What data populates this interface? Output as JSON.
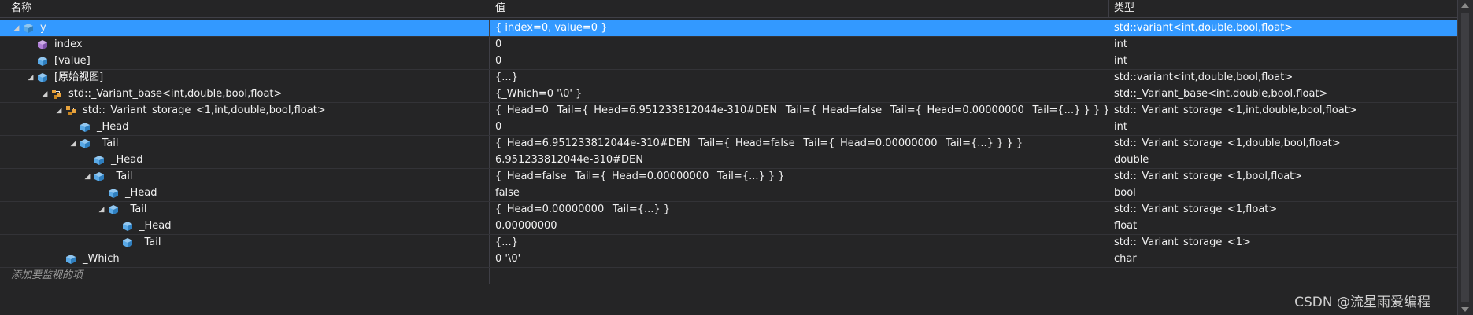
{
  "columns": {
    "name": "名称",
    "value": "值",
    "type": "类型"
  },
  "colors": {
    "selection": "#3399ff",
    "background": "#252526",
    "member_icon": "#5aa9e6",
    "field_icon": "#b180d7",
    "base_icon": "#e8a33d"
  },
  "rows": [
    {
      "level": 0,
      "expander": "open",
      "icon": "field-icon",
      "name": "y",
      "value": "{ index=0, value=0 }",
      "type": "std::variant<int,double,bool,float>",
      "selected": true
    },
    {
      "level": 1,
      "expander": "none",
      "icon": "field-purple-icon",
      "name": "index",
      "value": "0",
      "type": "int"
    },
    {
      "level": 1,
      "expander": "none",
      "icon": "field-icon",
      "name": "[value]",
      "value": "0",
      "type": "int"
    },
    {
      "level": 1,
      "expander": "open",
      "icon": "field-icon",
      "name": "[原始视图]",
      "value": "{...}",
      "type": "std::variant<int,double,bool,float>"
    },
    {
      "level": 2,
      "expander": "open",
      "icon": "base-class-icon",
      "name": "std::_Variant_base<int,double,bool,float>",
      "value": "{_Which=0 '\\0' }",
      "type": "std::_Variant_base<int,double,bool,float>"
    },
    {
      "level": 3,
      "expander": "open",
      "icon": "base-class-icon",
      "name": "std::_Variant_storage_<1,int,double,bool,float>",
      "value": "{_Head=0 _Tail={_Head=6.951233812044e-310#DEN _Tail={_Head=false _Tail={_Head=0.00000000 _Tail={...} } } } }",
      "type": "std::_Variant_storage_<1,int,double,bool,float>"
    },
    {
      "level": 4,
      "expander": "none",
      "icon": "field-icon",
      "name": "_Head",
      "value": "0",
      "type": "int"
    },
    {
      "level": 4,
      "expander": "open",
      "icon": "field-icon",
      "name": "_Tail",
      "value": "{_Head=6.951233812044e-310#DEN _Tail={_Head=false _Tail={_Head=0.00000000 _Tail={...} } } }",
      "type": "std::_Variant_storage_<1,double,bool,float>"
    },
    {
      "level": 5,
      "expander": "none",
      "icon": "field-icon",
      "name": "_Head",
      "value": "6.951233812044e-310#DEN",
      "type": "double"
    },
    {
      "level": 5,
      "expander": "open",
      "icon": "field-icon",
      "name": "_Tail",
      "value": "{_Head=false _Tail={_Head=0.00000000 _Tail={...} } }",
      "type": "std::_Variant_storage_<1,bool,float>"
    },
    {
      "level": 6,
      "expander": "none",
      "icon": "field-icon",
      "name": "_Head",
      "value": "false",
      "type": "bool"
    },
    {
      "level": 6,
      "expander": "open",
      "icon": "field-icon",
      "name": "_Tail",
      "value": "{_Head=0.00000000 _Tail={...} }",
      "type": "std::_Variant_storage_<1,float>"
    },
    {
      "level": 7,
      "expander": "none",
      "icon": "field-icon",
      "name": "_Head",
      "value": "0.00000000",
      "type": "float"
    },
    {
      "level": 7,
      "expander": "none",
      "icon": "field-icon",
      "name": "_Tail",
      "value": "{...}",
      "type": "std::_Variant_storage_<1>"
    },
    {
      "level": 3,
      "expander": "none",
      "icon": "field-icon",
      "name": "_Which",
      "value": "0 '\\0'",
      "type": "char"
    }
  ],
  "add_watch": "添加要监视的项",
  "watermark": "CSDN @流星雨爱编程"
}
